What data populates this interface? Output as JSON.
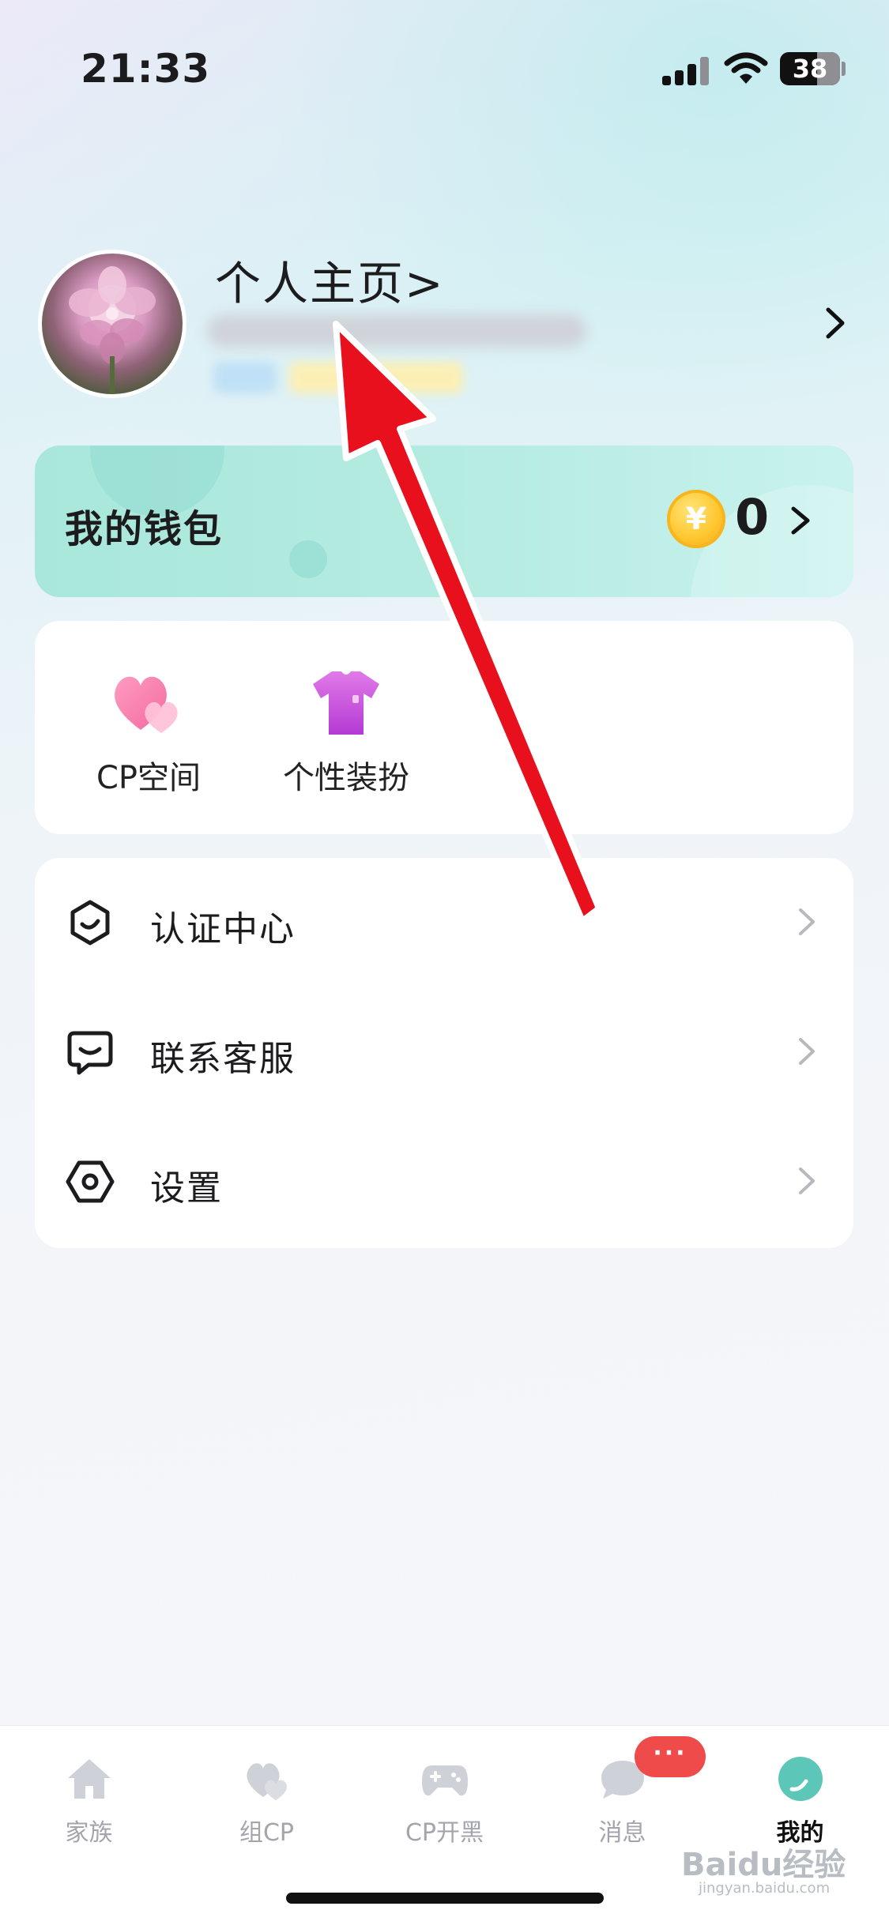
{
  "status_bar": {
    "time": "21:33",
    "battery": "38"
  },
  "profile": {
    "title": "个人主页>"
  },
  "wallet": {
    "label": "我的钱包",
    "coin_symbol": "¥",
    "amount": "0"
  },
  "features": [
    {
      "label": "CP空间",
      "icon": "hearts-icon"
    },
    {
      "label": "个性装扮",
      "icon": "tshirt-icon"
    }
  ],
  "menu": [
    {
      "label": "认证中心",
      "icon": "verification-icon"
    },
    {
      "label": "联系客服",
      "icon": "customer-service-icon"
    },
    {
      "label": "设置",
      "icon": "settings-icon"
    }
  ],
  "tabbar": {
    "tabs": [
      {
        "label": "家族",
        "icon": "home-icon"
      },
      {
        "label": "组CP",
        "icon": "hearts-icon"
      },
      {
        "label": "CP开黑",
        "icon": "gamepad-icon"
      },
      {
        "label": "消息",
        "icon": "message-icon"
      },
      {
        "label": "我的",
        "icon": "profile-icon"
      }
    ],
    "active_tab": "我的",
    "message_badge": "···"
  },
  "watermark": {
    "text": "Baidu经验",
    "sub": "jingyan.baidu.com"
  },
  "colors": {
    "accent": "#5cc6b8",
    "wallet_bg": "#b6ece2",
    "badge": "#ef4b4b",
    "arrow": "#e8101c"
  }
}
